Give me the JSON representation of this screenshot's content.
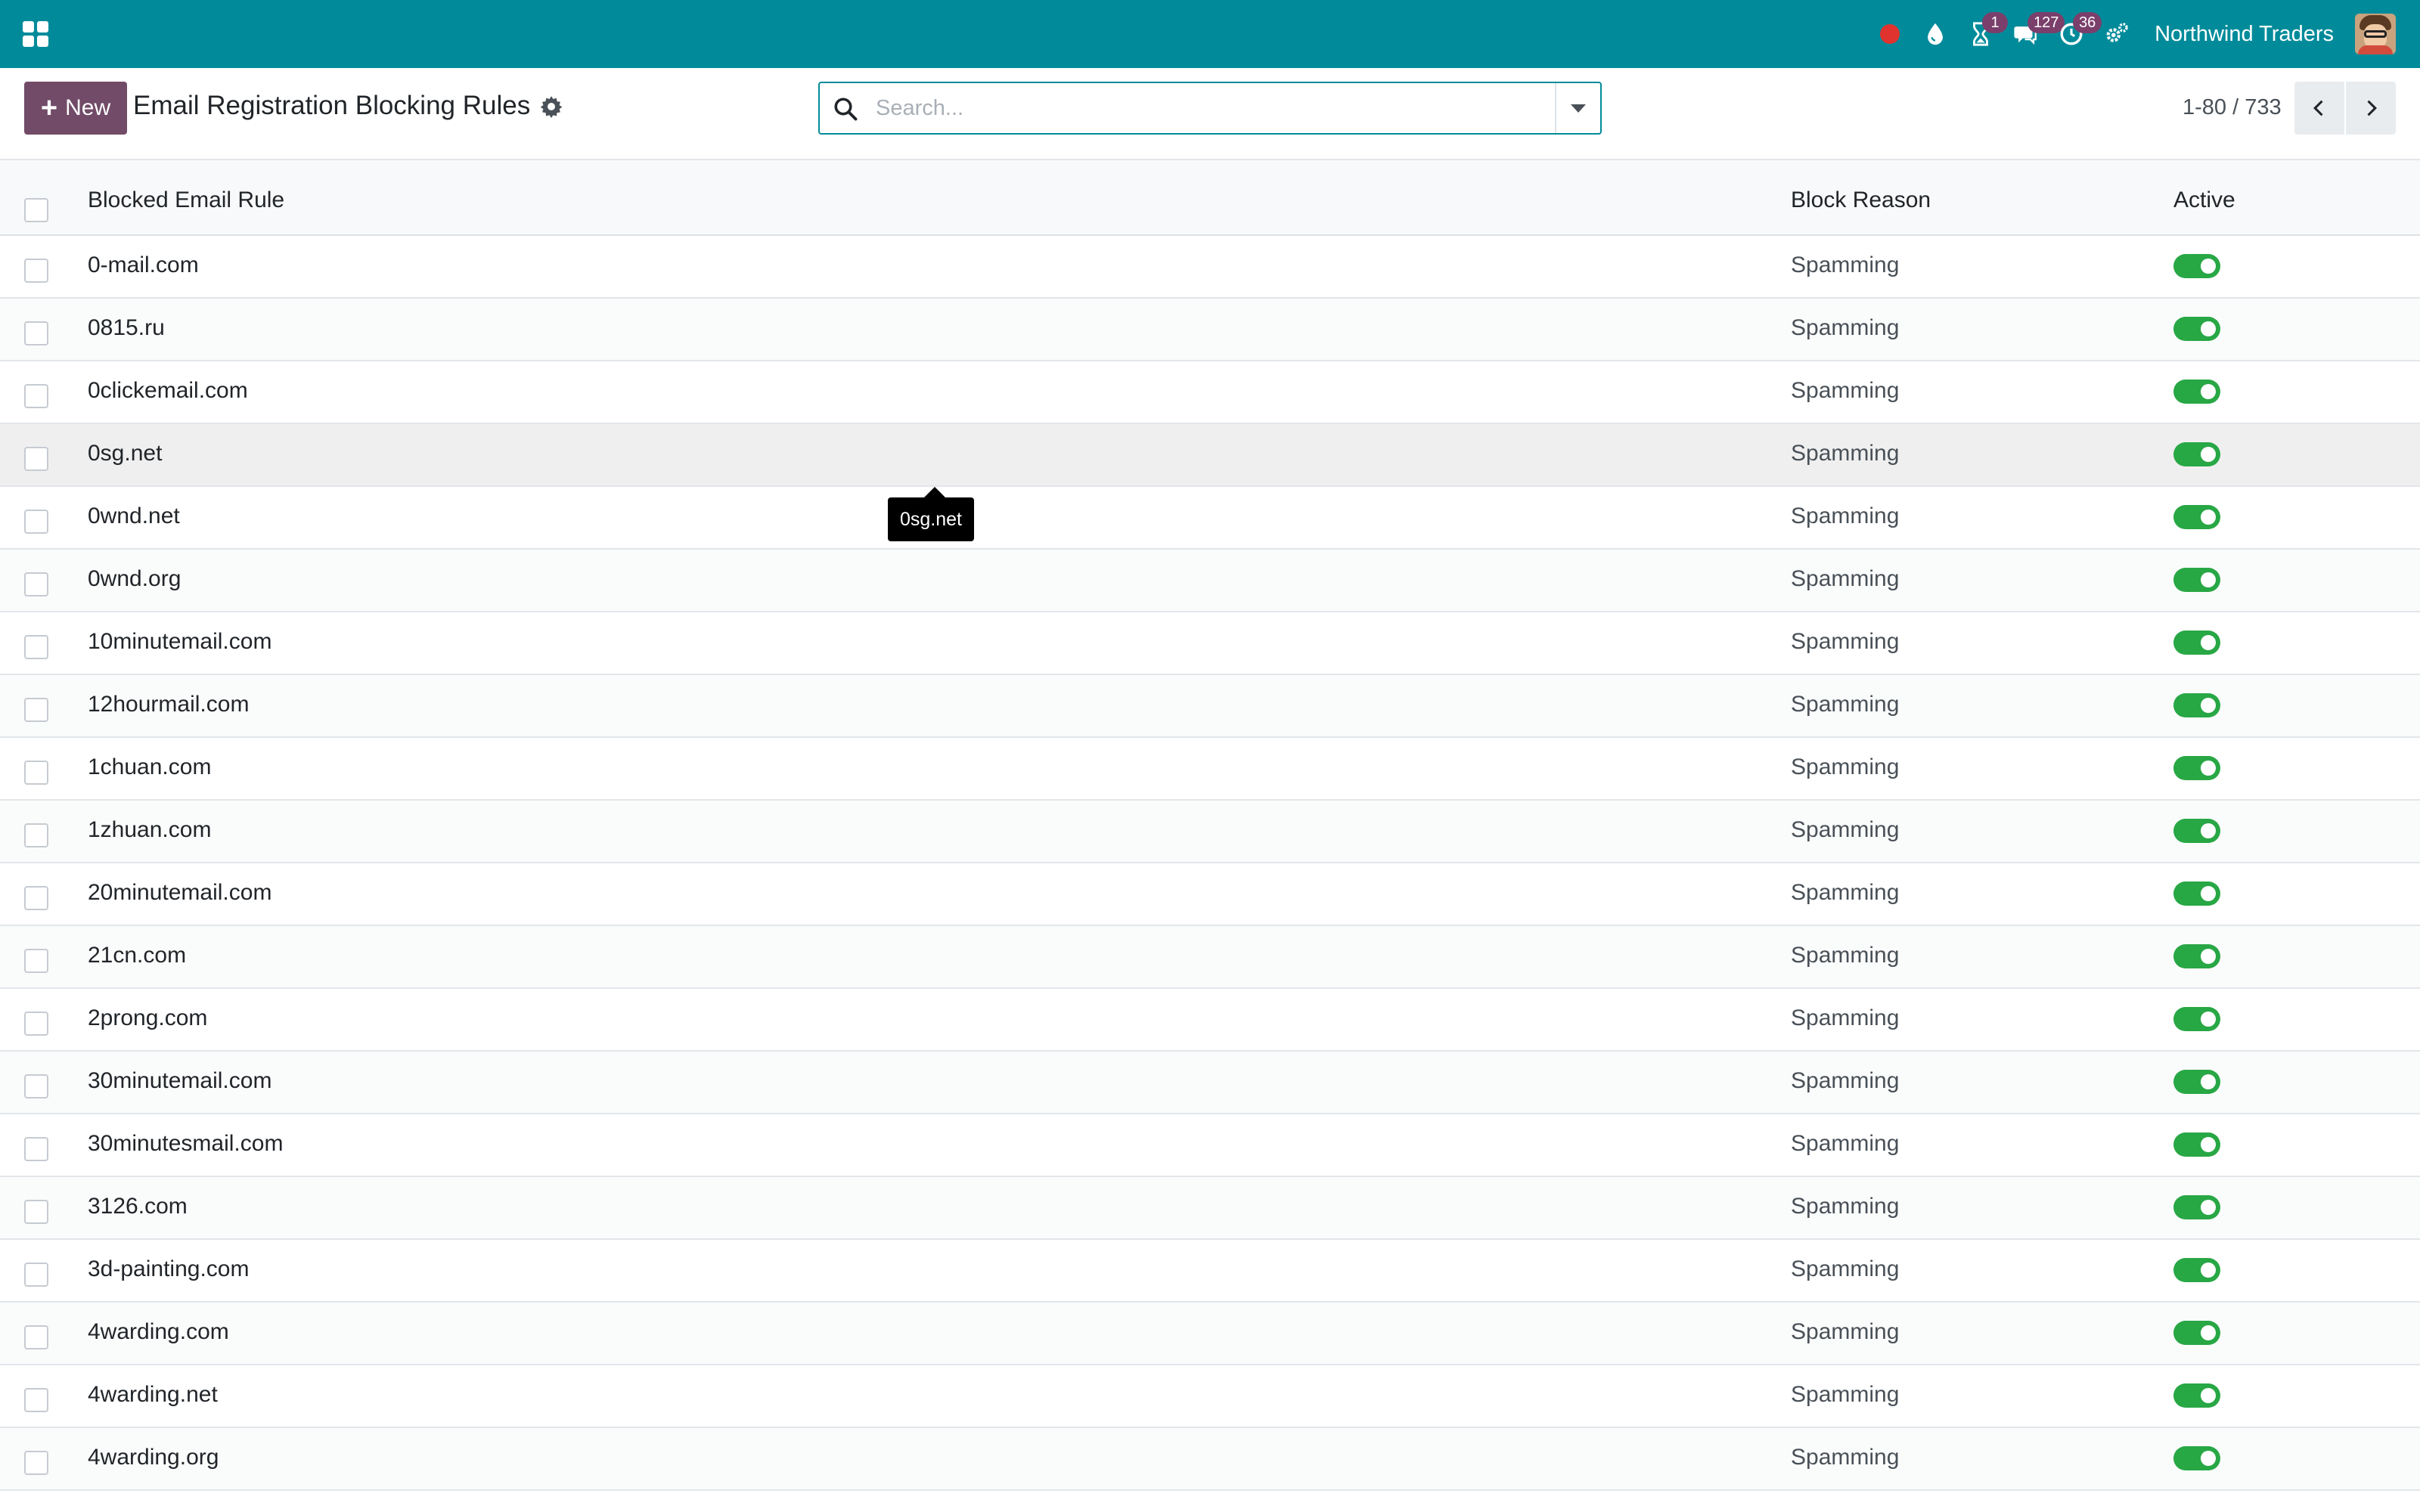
{
  "navbar": {
    "company": "Northwind Traders",
    "badges": {
      "activity": "1",
      "messages": "127",
      "timer": "36"
    },
    "icons": [
      "apps-icon",
      "record-icon",
      "drop-icon",
      "hourglass-icon",
      "chat-icon",
      "clock-icon",
      "settings-icon"
    ]
  },
  "control": {
    "new_label": "New",
    "title": "Email Registration Blocking Rules",
    "search_placeholder": "Search...",
    "pager": "1-80 / 733"
  },
  "list": {
    "columns": {
      "name": "Blocked Email Rule",
      "reason": "Block Reason",
      "active": "Active"
    },
    "rows": [
      {
        "name": "0-mail.com",
        "reason": "Spamming",
        "active": true
      },
      {
        "name": "0815.ru",
        "reason": "Spamming",
        "active": true
      },
      {
        "name": "0clickemail.com",
        "reason": "Spamming",
        "active": true
      },
      {
        "name": "0sg.net",
        "reason": "Spamming",
        "active": true
      },
      {
        "name": "0wnd.net",
        "reason": "Spamming",
        "active": true
      },
      {
        "name": "0wnd.org",
        "reason": "Spamming",
        "active": true
      },
      {
        "name": "10minutemail.com",
        "reason": "Spamming",
        "active": true
      },
      {
        "name": "12hourmail.com",
        "reason": "Spamming",
        "active": true
      },
      {
        "name": "1chuan.com",
        "reason": "Spamming",
        "active": true
      },
      {
        "name": "1zhuan.com",
        "reason": "Spamming",
        "active": true
      },
      {
        "name": "20minutemail.com",
        "reason": "Spamming",
        "active": true
      },
      {
        "name": "21cn.com",
        "reason": "Spamming",
        "active": true
      },
      {
        "name": "2prong.com",
        "reason": "Spamming",
        "active": true
      },
      {
        "name": "30minutemail.com",
        "reason": "Spamming",
        "active": true
      },
      {
        "name": "30minutesmail.com",
        "reason": "Spamming",
        "active": true
      },
      {
        "name": "3126.com",
        "reason": "Spamming",
        "active": true
      },
      {
        "name": "3d-painting.com",
        "reason": "Spamming",
        "active": true
      },
      {
        "name": "4warding.com",
        "reason": "Spamming",
        "active": true
      },
      {
        "name": "4warding.net",
        "reason": "Spamming",
        "active": true
      },
      {
        "name": "4warding.org",
        "reason": "Spamming",
        "active": true
      }
    ]
  },
  "tooltip": "0sg.net",
  "colors": {
    "navbar": "#018b9a",
    "primary_button": "#714b67",
    "toggle_on": "#28a745",
    "badge": "#7a3f6b",
    "record": "#e0332f"
  }
}
